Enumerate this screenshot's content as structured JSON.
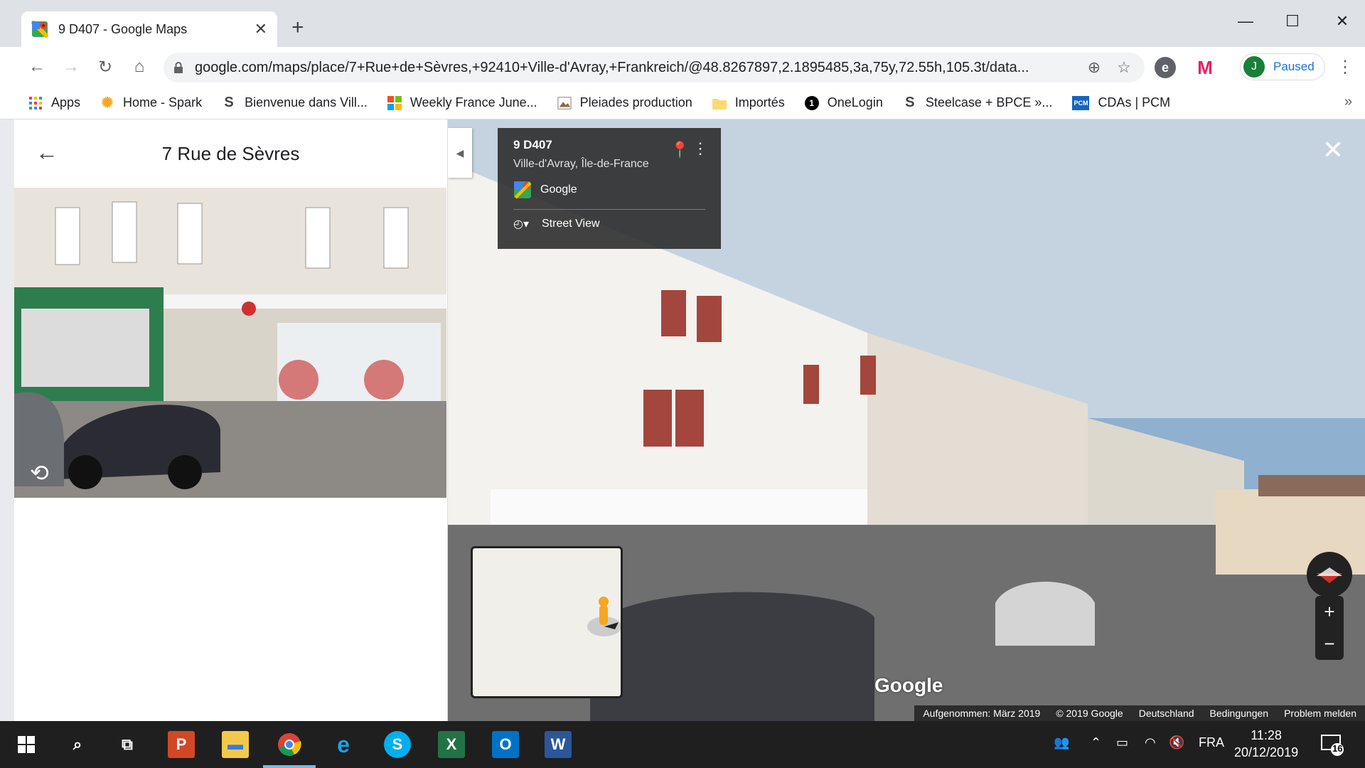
{
  "browser": {
    "tab_title": "9 D407 - Google Maps",
    "new_tab": "+",
    "url": "google.com/maps/place/7+Rue+de+Sèvres,+92410+Ville-d'Avray,+Frankreich/@48.8267897,2.1895485,3a,75y,72.55h,105.3t/data...",
    "profile_initial": "J",
    "profile_label": "Paused"
  },
  "bookmarks": [
    {
      "label": "Apps",
      "icon": "apps-grid-icon"
    },
    {
      "label": "Home - Spark",
      "icon": "spark-icon"
    },
    {
      "label": "Bienvenue dans Vill...",
      "icon": "s-icon"
    },
    {
      "label": "Weekly France June...",
      "icon": "windows-logo-icon"
    },
    {
      "label": "Pleiades production",
      "icon": "picture-icon"
    },
    {
      "label": "Importés",
      "icon": "folder-icon"
    },
    {
      "label": "OneLogin",
      "icon": "onelogin-icon"
    },
    {
      "label": "Steelcase + BPCE »...",
      "icon": "s-icon"
    },
    {
      "label": "CDAs | PCM",
      "icon": "pcm-icon"
    }
  ],
  "sidepanel": {
    "title": "7 Rue de Sèvres"
  },
  "streetview": {
    "info_title": "9 D407",
    "info_subtitle": "Ville-d'Avray, Île-de-France",
    "info_provider": "Google",
    "info_mode": "Street View",
    "watermark": "Google",
    "attribution": [
      "Aufgenommen: März 2019",
      "© 2019 Google",
      "Deutschland",
      "Bedingungen",
      "Problem melden"
    ],
    "zoom_in": "+",
    "zoom_out": "−"
  },
  "taskbar": {
    "language": "FRA",
    "time": "11:28",
    "date": "20/12/2019",
    "notifications": "16"
  },
  "colors": {
    "accent": "#1a73e8",
    "taskbar": "#1f1f1f",
    "profile_green": "#188038"
  }
}
